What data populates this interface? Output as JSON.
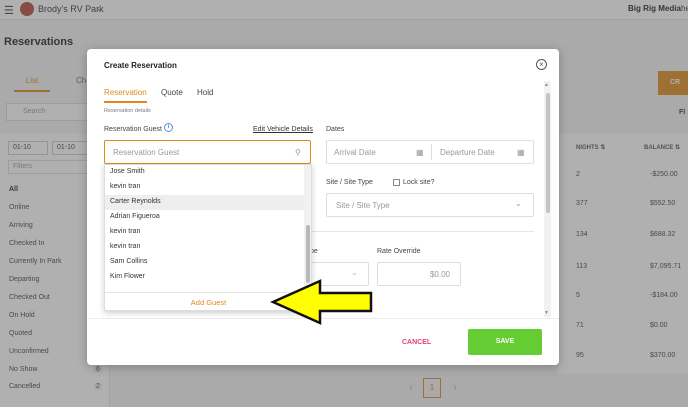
{
  "app": {
    "park_name": "Brody's RV Park",
    "brand": "Big Rig Media",
    "user_initials": "he"
  },
  "page": {
    "title": "Reservations",
    "tab_list": "List",
    "tab_other": "Ch",
    "search_placeholder": "Search",
    "date_from": "01-10",
    "date_to": "01-10",
    "filters_placeholder": "Filters",
    "filter_items": [
      {
        "label": "All",
        "count": ""
      },
      {
        "label": "Online",
        "count": ""
      },
      {
        "label": "Arriving",
        "count": ""
      },
      {
        "label": "Checked In",
        "count": ""
      },
      {
        "label": "Currently In Park",
        "count": ""
      },
      {
        "label": "Departing",
        "count": ""
      },
      {
        "label": "Checked Out",
        "count": ""
      },
      {
        "label": "On Hold",
        "count": ""
      },
      {
        "label": "Quoted",
        "count": ""
      },
      {
        "label": "Unconfirmed",
        "count": ""
      },
      {
        "label": "No Show",
        "count": "6"
      },
      {
        "label": "Cancelled",
        "count": "2"
      }
    ],
    "create_button_partial": "CR",
    "filter_label_partial": "FI",
    "table": {
      "headers": [
        "NIGHTS",
        "BALANCE"
      ],
      "rows": [
        {
          "nights": "2",
          "balance": "-$250.00"
        },
        {
          "nights": "377",
          "balance": "$552.50"
        },
        {
          "nights": "134",
          "balance": "$688.32"
        },
        {
          "nights": "113",
          "balance": "$7,095.71"
        },
        {
          "nights": "5",
          "balance": "-$184.00"
        },
        {
          "nights": "71",
          "balance": "$0.00"
        },
        {
          "nights": "95",
          "balance": "$370.00"
        }
      ]
    },
    "pager": {
      "current": "1"
    }
  },
  "modal": {
    "title": "Create Reservation",
    "tabs": [
      "Reservation",
      "Quote",
      "Hold"
    ],
    "subtitle": "Reservation details",
    "guest_label": "Reservation Guest",
    "edit_vehicle_label": "Edit Vehicle Details",
    "guest_placeholder": "Reservation Guest",
    "dates_label": "Dates",
    "arrival_placeholder": "Arrival Date",
    "departure_placeholder": "Departure Date",
    "site_type_label": "Site / Site Type",
    "lock_site_label": "Lock site?",
    "site_type_placeholder": "Site / Site Type",
    "rate_type_label_partial": "pe",
    "rate_override_label": "Rate Override",
    "rate_override_value": "$0.00",
    "cancel_label": "CANCEL",
    "save_label": "SAVE"
  },
  "guest_dropdown": {
    "items": [
      "Jose Smith",
      "kevin tran",
      "Carter Reynolds",
      "Adrian Figueroa",
      "kevin tran",
      "kevin tran",
      "Sam Collins",
      "Kim Flower"
    ],
    "highlighted_index": 2,
    "add_guest_label": "Add Guest"
  },
  "colors": {
    "accent": "#e08a1e",
    "save": "#66cc33",
    "cancel": "#e0457b",
    "arrow_fill": "#ffff00"
  },
  "icons": [
    "menu-icon",
    "avatar",
    "chevron-down-icon",
    "close-icon",
    "info-icon",
    "search-icon",
    "calendar-icon",
    "chevron-left-icon",
    "chevron-right-icon",
    "arrow-annotation"
  ]
}
